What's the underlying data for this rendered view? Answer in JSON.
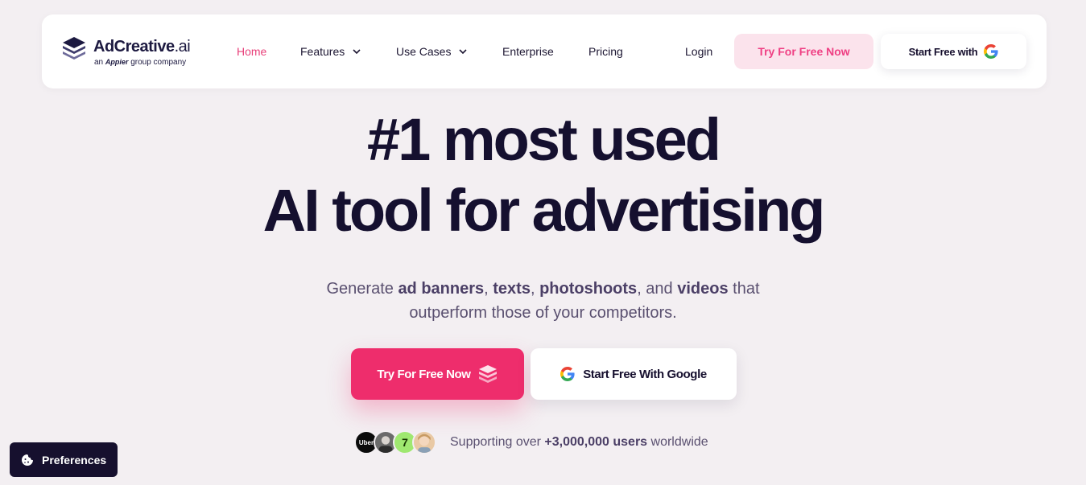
{
  "colors": {
    "accent": "#ee2d6c",
    "nav_active": "#e8407a",
    "dark": "#15102f",
    "background": "#f3eff2"
  },
  "logo": {
    "name_main": "AdCreative",
    "name_suffix": ".ai",
    "sub_prefix": "an",
    "sub_brand": "Appier",
    "sub_suffix": "group company"
  },
  "nav": {
    "items": [
      {
        "label": "Home",
        "active": true
      },
      {
        "label": "Features",
        "dropdown": true
      },
      {
        "label": "Use Cases",
        "dropdown": true
      },
      {
        "label": "Enterprise"
      },
      {
        "label": "Pricing"
      }
    ],
    "login": "Login",
    "try_button": "Try For Free Now",
    "google_button": "Start Free with"
  },
  "hero": {
    "line1": "#1 most used",
    "line2": "AI tool for advertising",
    "sub": {
      "t1": "Generate ",
      "b1": "ad banners",
      "t2": ", ",
      "b2": "texts",
      "t3": ", ",
      "b3": "photoshoots",
      "t4": ", and ",
      "b4": "videos",
      "t5": " that",
      "line2": "outperform those of your competitors."
    },
    "cta_try": "Try For Free Now",
    "cta_google": "Start Free With Google"
  },
  "social": {
    "avatars": [
      {
        "name": "uber-logo",
        "text": "Uber",
        "color": "#0b0b0b"
      },
      {
        "name": "person-avatar-1",
        "text": "",
        "color": "#6b6b6b"
      },
      {
        "name": "wise-logo",
        "text": "7",
        "color": "#9fe870"
      },
      {
        "name": "person-avatar-2",
        "text": "",
        "color": "#e9c9a4"
      }
    ],
    "prefix": "Supporting over ",
    "count": "+3,000,000 users",
    "suffix": " worldwide"
  },
  "preferences": {
    "label": "Preferences"
  }
}
